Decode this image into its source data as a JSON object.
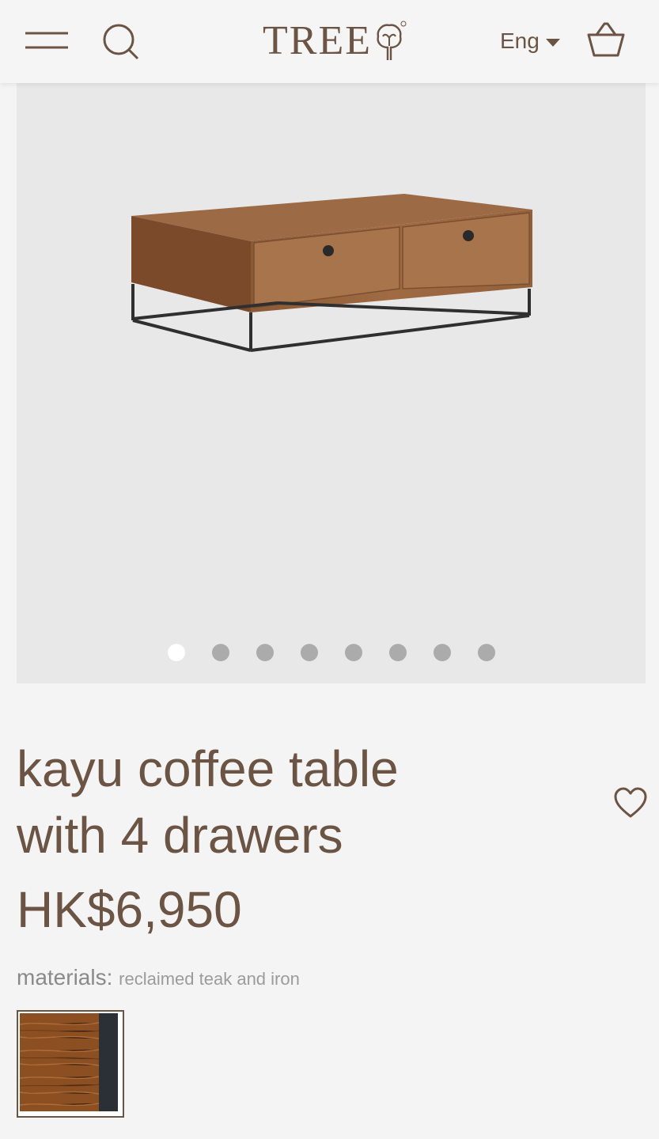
{
  "header": {
    "logo_text": "TREE",
    "language": "Eng"
  },
  "gallery": {
    "image_count": 8,
    "active_index": 0
  },
  "product": {
    "title_line1": "kayu coffee table",
    "title_line2": "with 4 drawers",
    "price": "HK$6,950",
    "materials_label": "materials:",
    "materials_value": "reclaimed teak and iron"
  },
  "colors": {
    "brand_brown": "#6b5444",
    "background": "#f4f4f4",
    "gallery_bg": "#e8e8e8",
    "dot_inactive": "#ababab",
    "dot_active": "#ffffff"
  },
  "icons": [
    "hamburger-menu-icon",
    "search-icon",
    "tree-logo-icon",
    "chevron-down-icon",
    "shopping-basket-icon",
    "heart-icon"
  ]
}
